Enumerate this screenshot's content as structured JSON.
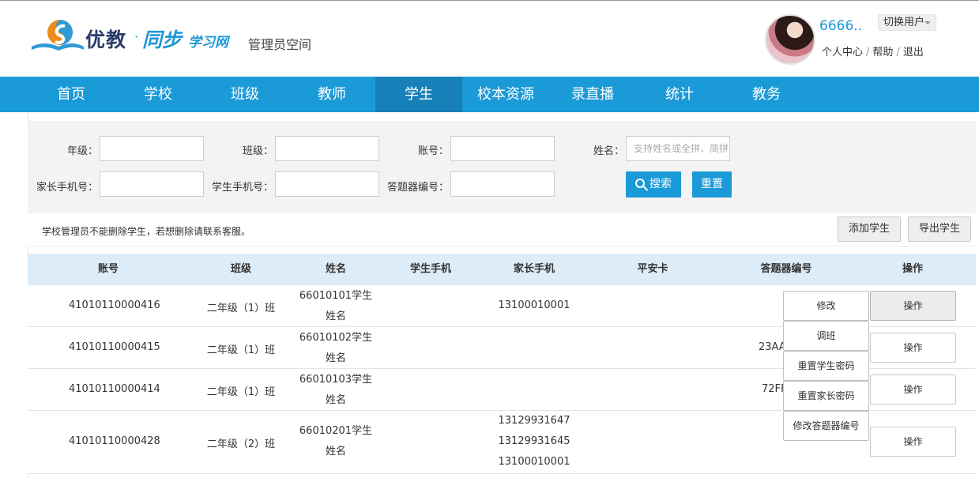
{
  "header": {
    "brand_main": "优教",
    "brand_dot": "·",
    "brand_sync": "同步",
    "brand_site": "学习网",
    "subtitle": "管理员空间",
    "username": "6666..",
    "switch_user": "切换用户",
    "links": [
      "个人中心",
      "帮助",
      "退出"
    ]
  },
  "nav": {
    "items": [
      "首页",
      "学校",
      "班级",
      "教师",
      "学生",
      "校本资源",
      "录直播",
      "统计",
      "教务"
    ],
    "active_index": 4
  },
  "search": {
    "fields": {
      "grade_label": "年级：",
      "class_label": "班级：",
      "account_label": "账号：",
      "name_label": "姓名：",
      "name_placeholder": "支持姓名或全拼、简拼",
      "parent_phone_label": "家长手机号：",
      "student_phone_label": "学生手机号：",
      "clicker_label": "答题器编号："
    },
    "search_button": "搜索",
    "reset_button": "重置"
  },
  "notice_bar": {
    "notice": "学校管理员不能删除学生，若想删除请联系客服。",
    "add_button": "添加学生",
    "export_button": "导出学生"
  },
  "table": {
    "columns": [
      "账号",
      "班级",
      "姓名",
      "学生手机",
      "家长手机",
      "平安卡",
      "答题器编号",
      "操作"
    ],
    "rows": [
      {
        "account": "41010110000416",
        "class": "二年级（1）班",
        "name_line1": "66010101学生",
        "name_line2": "姓名",
        "parent_phones": [
          "13100010001"
        ],
        "clicker": "",
        "op": "操作"
      },
      {
        "account": "41010110000415",
        "class": "二年级（1）班",
        "name_line1": "66010102学生",
        "name_line2": "姓名",
        "parent_phones": [],
        "clicker": "23AA",
        "op": "操作"
      },
      {
        "account": "41010110000414",
        "class": "二年级（1）班",
        "name_line1": "66010103学生",
        "name_line2": "姓名",
        "parent_phones": [],
        "clicker": "72FF",
        "op": "操作"
      },
      {
        "account": "41010110000428",
        "class": "二年级（2）班",
        "name_line1": "66010201学生",
        "name_line2": "姓名",
        "parent_phones": [
          "13129931647",
          "13129931645",
          "13100010001"
        ],
        "clicker": "",
        "op": "操作"
      }
    ],
    "dropdown": [
      "修改",
      "调班",
      "重置学生密码",
      "重置家长密码",
      "修改答题器编号"
    ]
  },
  "colors": {
    "nav_bg": "#1b9ad8",
    "nav_active": "#1780b8",
    "table_header_bg": "#dcecf9",
    "accent_blue": "#1e97d6"
  }
}
